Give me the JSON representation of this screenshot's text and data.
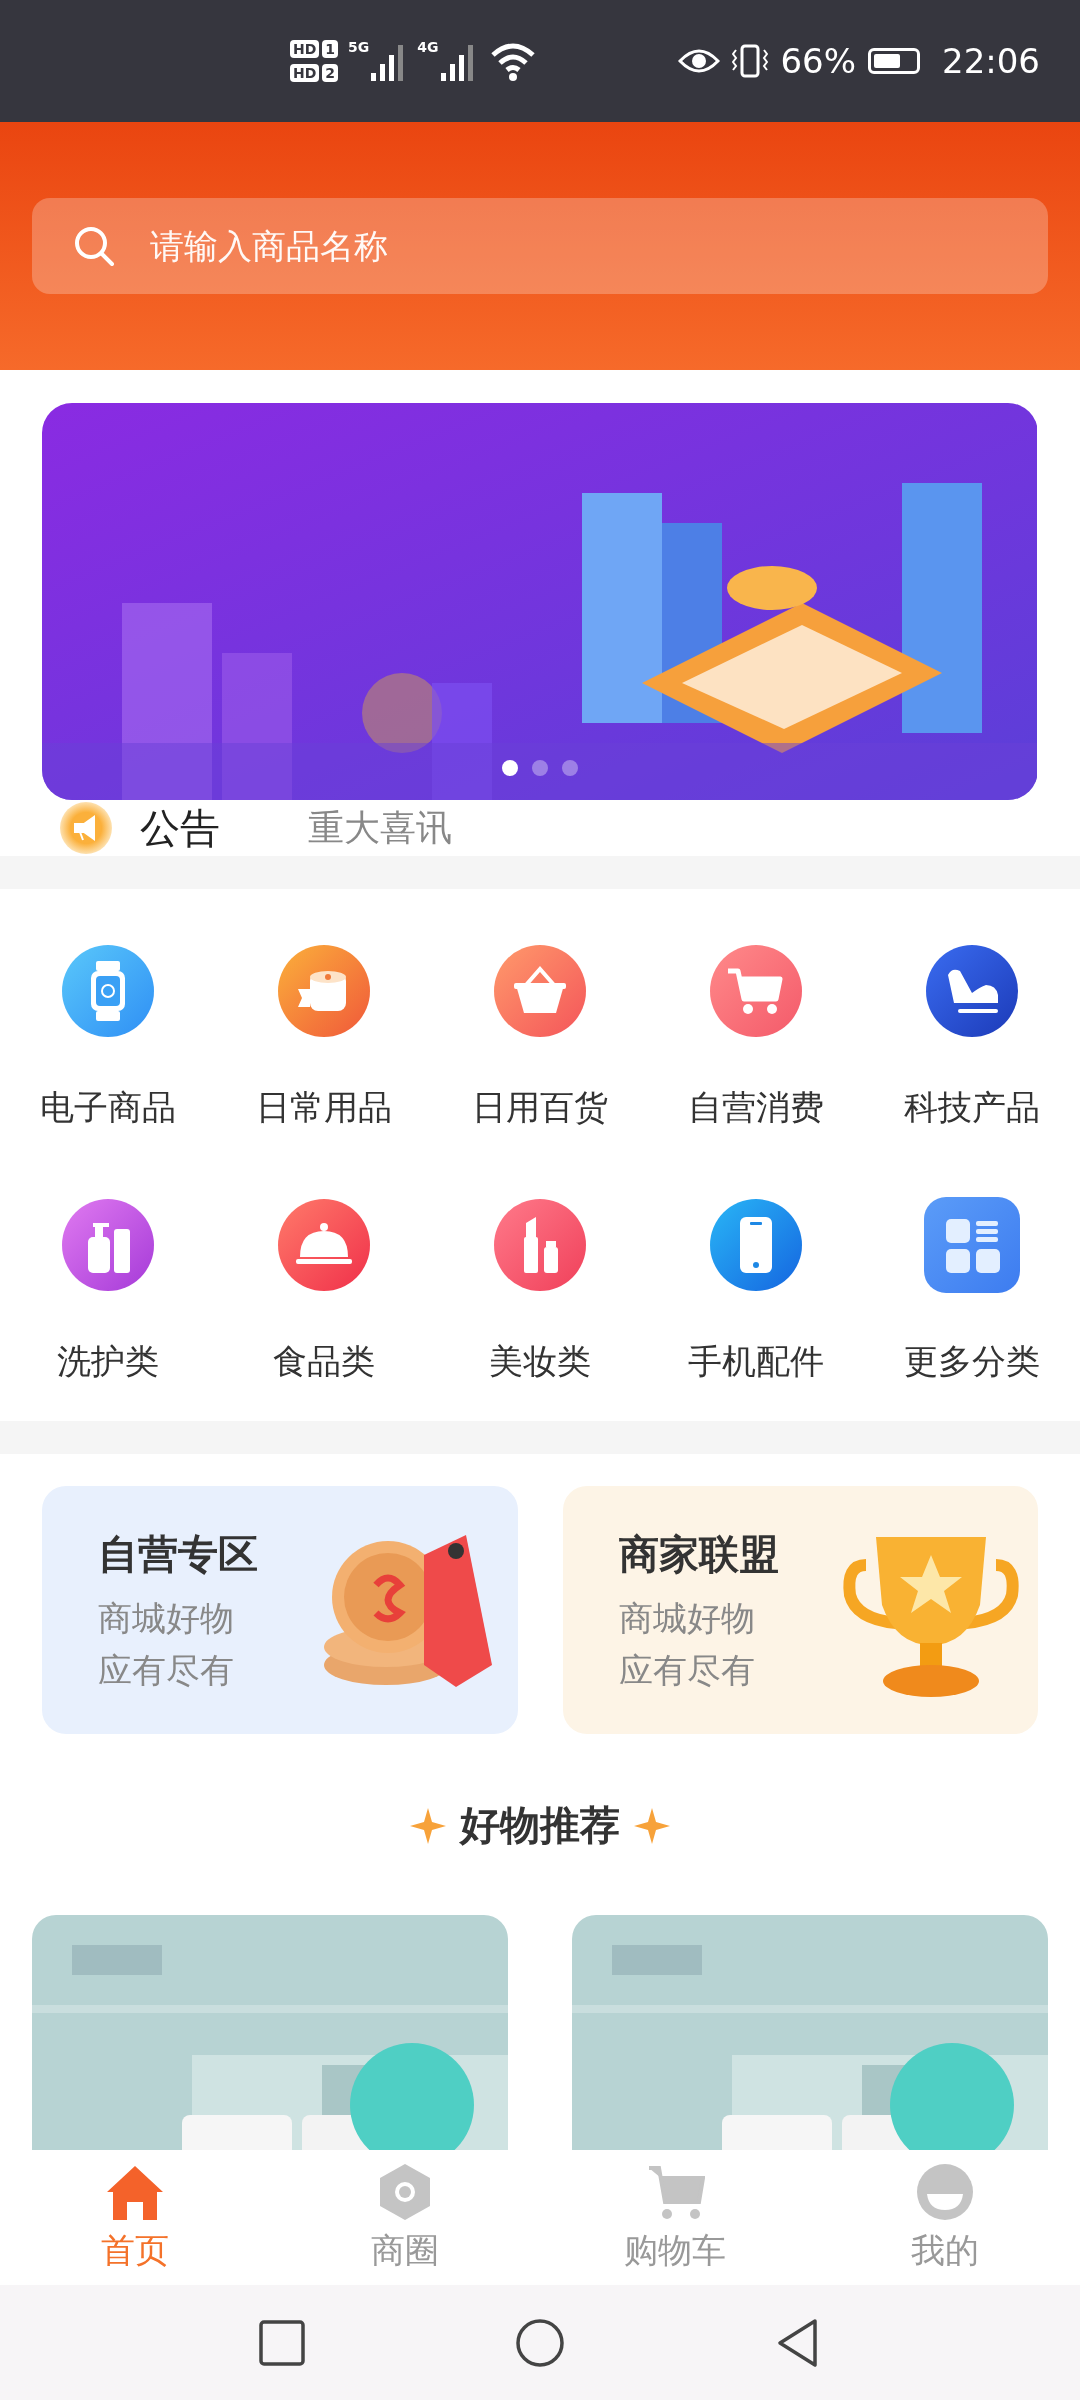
{
  "status_bar": {
    "sims": [
      {
        "hd": "HD",
        "slot": "1",
        "network": "5G"
      },
      {
        "hd": "HD",
        "slot": "2",
        "network": "4G"
      }
    ],
    "battery_text": "66%",
    "time": "22:06"
  },
  "search": {
    "placeholder": "请输入商品名称"
  },
  "banner": {
    "kind": "picture",
    "dots": [
      {
        "selected": true
      },
      {
        "selected": false
      },
      {
        "selected": false
      }
    ]
  },
  "notice": {
    "label": "公告",
    "text": "重大喜讯"
  },
  "categories": [
    {
      "label": "电子商品",
      "kind": "watch"
    },
    {
      "label": "日常用品",
      "kind": "roll"
    },
    {
      "label": "日用百货",
      "kind": "basket"
    },
    {
      "label": "自营消费",
      "kind": "cart"
    },
    {
      "label": "科技产品",
      "kind": "chair"
    },
    {
      "label": "洗护类",
      "kind": "bottles"
    },
    {
      "label": "食品类",
      "kind": "cloche"
    },
    {
      "label": "美妆类",
      "kind": "lipstick"
    },
    {
      "label": "手机配件",
      "kind": "phone"
    },
    {
      "label": "更多分类",
      "kind": "grid"
    }
  ],
  "promos": [
    {
      "title": "自营专区",
      "lines": [
        "商城好物",
        "应有尽有"
      ],
      "kind": "sale"
    },
    {
      "title": "商家联盟",
      "lines": [
        "商城好物",
        "应有尽有"
      ],
      "kind": "trophy"
    }
  ],
  "section_title": "好物推荐",
  "tabs": [
    {
      "label": "首页",
      "kind": "home",
      "selected": true
    },
    {
      "label": "商圈",
      "kind": "hexagon",
      "selected": false
    },
    {
      "label": "购物车",
      "kind": "cart",
      "selected": false
    },
    {
      "label": "我的",
      "kind": "face",
      "selected": false
    }
  ]
}
